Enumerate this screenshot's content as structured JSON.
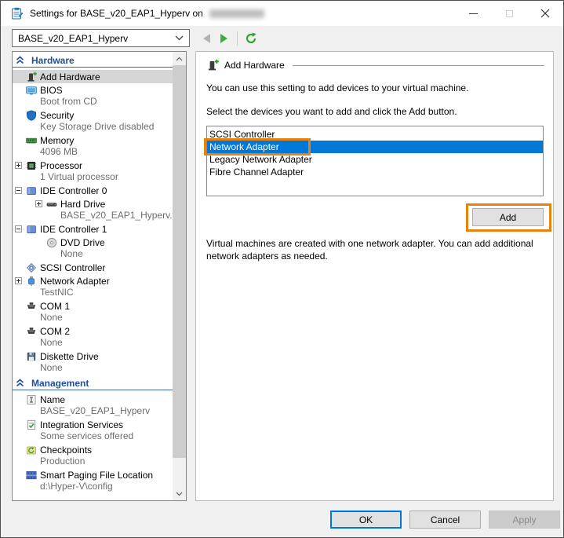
{
  "window": {
    "title": "Settings for BASE_v20_EAP1_Hyperv on",
    "host_redacted": true
  },
  "toolbar": {
    "vm_selector_value": "BASE_v20_EAP1_Hyperv"
  },
  "sidebar": {
    "sections": [
      {
        "title": "Hardware",
        "items": [
          {
            "label": "Add Hardware",
            "icon": "add-hardware-icon",
            "selected": true
          },
          {
            "label": "BIOS",
            "sublabel": "Boot from CD",
            "icon": "bios-icon"
          },
          {
            "label": "Security",
            "sublabel": "Key Storage Drive disabled",
            "icon": "security-shield-icon"
          },
          {
            "label": "Memory",
            "sublabel": "4096 MB",
            "icon": "memory-icon"
          },
          {
            "label": "Processor",
            "sublabel": "1 Virtual processor",
            "icon": "processor-icon",
            "expander": "plus"
          },
          {
            "label": "IDE Controller 0",
            "icon": "ide-controller-icon",
            "expander": "minus"
          },
          {
            "label": "Hard Drive",
            "sublabel": "BASE_v20_EAP1_Hyperv.v...",
            "icon": "hard-drive-icon",
            "expander": "plus",
            "level": 2
          },
          {
            "label": "IDE Controller 1",
            "icon": "ide-controller-icon",
            "expander": "minus"
          },
          {
            "label": "DVD Drive",
            "sublabel": "None",
            "icon": "dvd-drive-icon",
            "level": 2
          },
          {
            "label": "SCSI Controller",
            "icon": "scsi-controller-icon"
          },
          {
            "label": "Network Adapter",
            "sublabel": "TestNIC",
            "icon": "network-adapter-icon",
            "expander": "plus"
          },
          {
            "label": "COM 1",
            "sublabel": "None",
            "icon": "com-port-icon"
          },
          {
            "label": "COM 2",
            "sublabel": "None",
            "icon": "com-port-icon"
          },
          {
            "label": "Diskette Drive",
            "sublabel": "None",
            "icon": "diskette-icon"
          }
        ]
      },
      {
        "title": "Management",
        "items": [
          {
            "label": "Name",
            "sublabel": "BASE_v20_EAP1_Hyperv",
            "icon": "name-icon"
          },
          {
            "label": "Integration Services",
            "sublabel": "Some services offered",
            "icon": "integration-services-icon"
          },
          {
            "label": "Checkpoints",
            "sublabel": "Production",
            "icon": "checkpoints-icon"
          },
          {
            "label": "Smart Paging File Location",
            "sublabel": "d:\\Hyper-V\\config",
            "icon": "smart-paging-icon"
          }
        ]
      }
    ]
  },
  "main": {
    "header": "Add Hardware",
    "description1": "You can use this setting to add devices to your virtual machine.",
    "description2": "Select the devices you want to add and click the Add button.",
    "device_list": [
      "SCSI Controller",
      "Network Adapter",
      "Legacy Network Adapter",
      "Fibre Channel Adapter"
    ],
    "selected_device": "Network Adapter",
    "add_button_label": "Add",
    "note": "Virtual machines are created with one network adapter. You can add additional network adapters as needed."
  },
  "footer": {
    "ok_label": "OK",
    "cancel_label": "Cancel",
    "apply_label": "Apply",
    "apply_enabled": false
  },
  "colors": {
    "selection_blue": "#0078d7",
    "annotation_orange": "#e8820c",
    "section_header_blue": "#1d4ea0"
  }
}
